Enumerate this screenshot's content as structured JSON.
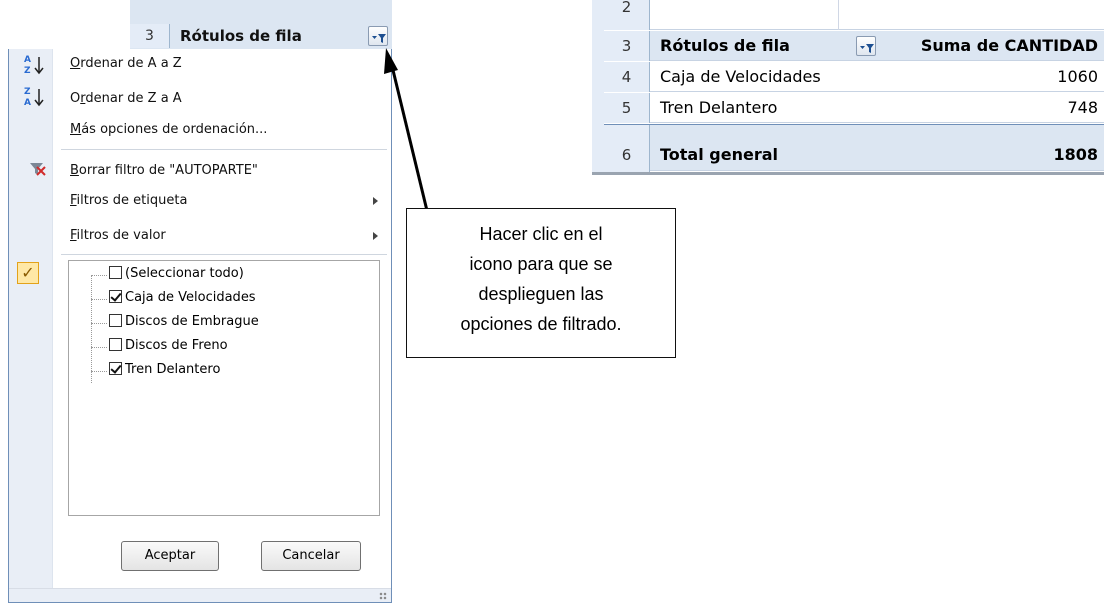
{
  "left_header": {
    "row_number": "3",
    "label": "Rótulos de fila"
  },
  "menu": {
    "sort_az": {
      "prefix_underlined": "O",
      "rest": "rdenar de A a Z"
    },
    "sort_za": {
      "prefix": "O",
      "underlined": "r",
      "rest": "denar de Z a A"
    },
    "more_sort": {
      "underlined": "M",
      "rest": "ás opciones de ordenación..."
    },
    "clear_filter": {
      "underlined": "B",
      "rest": "orrar filtro de \"AUTOPARTE\""
    },
    "label_filters": {
      "underlined": "F",
      "rest": "iltros de etiqueta"
    },
    "value_filters": {
      "underlined": "F",
      "rest": "iltros de valor"
    }
  },
  "values": {
    "select_all": "(Seleccionar todo)",
    "items": [
      {
        "label": "Caja de Velocidades",
        "checked": true
      },
      {
        "label": "Discos de Embrague",
        "checked": false
      },
      {
        "label": "Discos de Freno",
        "checked": false
      },
      {
        "label": "Tren Delantero",
        "checked": true
      }
    ]
  },
  "buttons": {
    "ok": "Aceptar",
    "cancel": "Cancelar"
  },
  "pivot": {
    "partial_row_number": "2",
    "header": {
      "row": "3",
      "label": "Rótulos de fila",
      "value_header": "Suma de CANTIDAD"
    },
    "rows": [
      {
        "row": "4",
        "label": "Caja de Velocidades",
        "value": "1060"
      },
      {
        "row": "5",
        "label": "Tren Delantero",
        "value": "748"
      }
    ],
    "total": {
      "row": "6",
      "label": "Total general",
      "value": "1808"
    }
  },
  "callout": {
    "line1": "Hacer clic en el",
    "line2": "icono para que se",
    "line3": "desplieguen las",
    "line4": "opciones de filtrado."
  },
  "colors": {
    "header_fill": "#dce6f2",
    "row_header_fill": "#e4ecf7",
    "panel_border": "#6f8fb8",
    "check_highlight": "#ffe8a6"
  },
  "icons": [
    "sort-az-icon",
    "sort-za-icon",
    "clear-filter-icon",
    "filter-dropdown-icon",
    "checkmark-icon",
    "submenu-arrow-icon"
  ]
}
